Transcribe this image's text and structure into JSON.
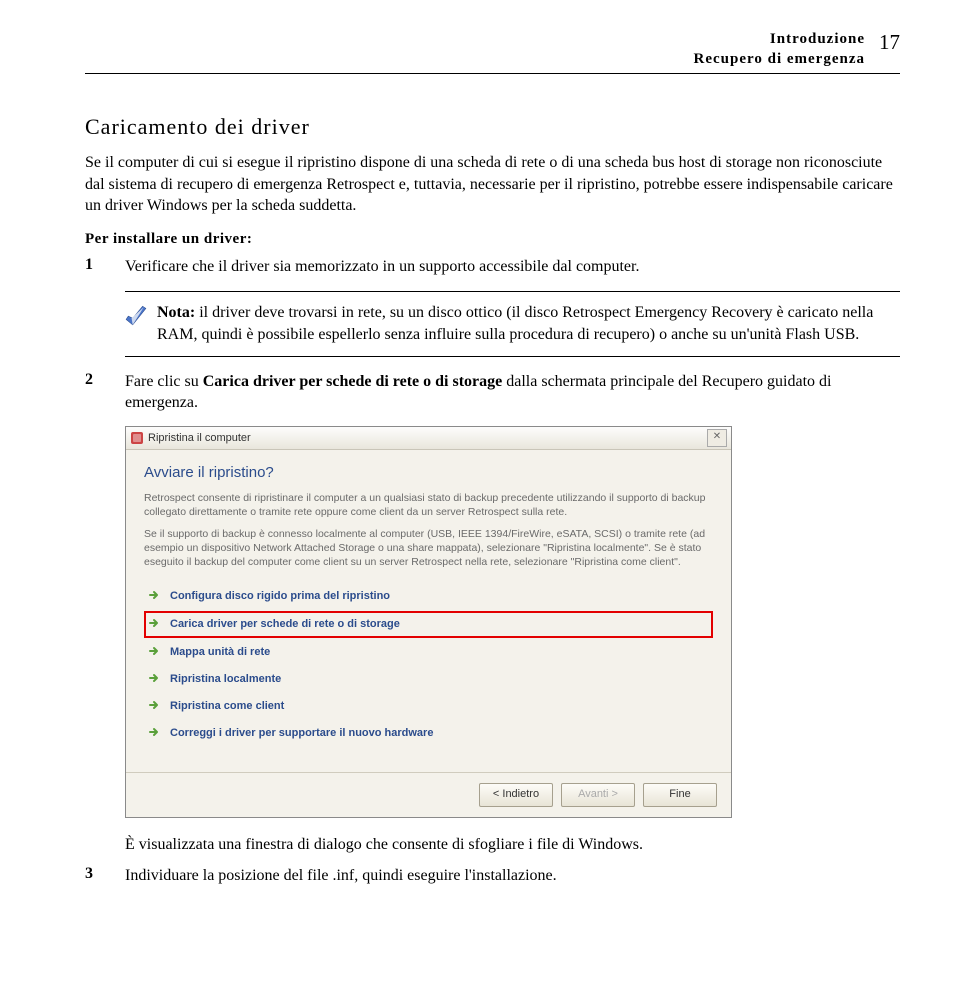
{
  "header": {
    "line1": "Introduzione",
    "line2": "Recupero di emergenza",
    "page_number": "17"
  },
  "section_title": "Caricamento dei driver",
  "intro_paragraph": "Se il computer di cui si esegue il ripristino dispone di una scheda di rete o di una scheda bus host di storage non riconosciute dal sistema di recupero di emergenza Retrospect e, tuttavia, necessarie per il ripristino, potrebbe essere indispensabile caricare un driver Windows per la scheda suddetta.",
  "subhead": "Per installare un driver:",
  "step1": {
    "num": "1",
    "text": "Verificare che il driver sia memorizzato in un supporto accessibile dal computer."
  },
  "note": {
    "label": "Nota:",
    "text": " il driver deve trovarsi in rete, su un disco ottico (il disco Retrospect Emergency Recovery è caricato nella RAM, quindi è possibile espellerlo senza influire sulla procedura di recupero) o anche su un'unità Flash USB."
  },
  "step2": {
    "num": "2",
    "pre": "Fare clic su ",
    "bold": "Carica driver per schede di rete o di storage",
    "post": " dalla schermata principale del Recupero guidato di emergenza."
  },
  "dialog": {
    "title": "Ripristina il computer",
    "heading": "Avviare il ripristino?",
    "para1": "Retrospect consente di ripristinare il computer a un qualsiasi stato di backup precedente utilizzando il supporto di backup collegato direttamente o tramite rete oppure come client da un server Retrospect sulla rete.",
    "para2": "Se il supporto di backup è connesso localmente al computer (USB, IEEE 1394/FireWire, eSATA, SCSI) o tramite rete (ad esempio un dispositivo Network Attached Storage o una share mappata), selezionare \"Ripristina localmente\". Se è stato eseguito il backup del computer come client su un server Retrospect nella rete, selezionare \"Ripristina come client\".",
    "options": [
      "Configura disco rigido prima del ripristino",
      "Carica driver per schede di rete o di storage",
      "Mappa unità di rete",
      "Ripristina localmente",
      "Ripristina come client",
      "Correggi i driver per supportare il nuovo hardware"
    ],
    "buttons": {
      "back": "< Indietro",
      "next": "Avanti >",
      "finish": "Fine"
    }
  },
  "after_dialog": "È visualizzata una finestra di dialogo che consente di sfogliare i file di Windows.",
  "step3": {
    "num": "3",
    "text": "Individuare la posizione del file .inf, quindi eseguire l'installazione."
  }
}
